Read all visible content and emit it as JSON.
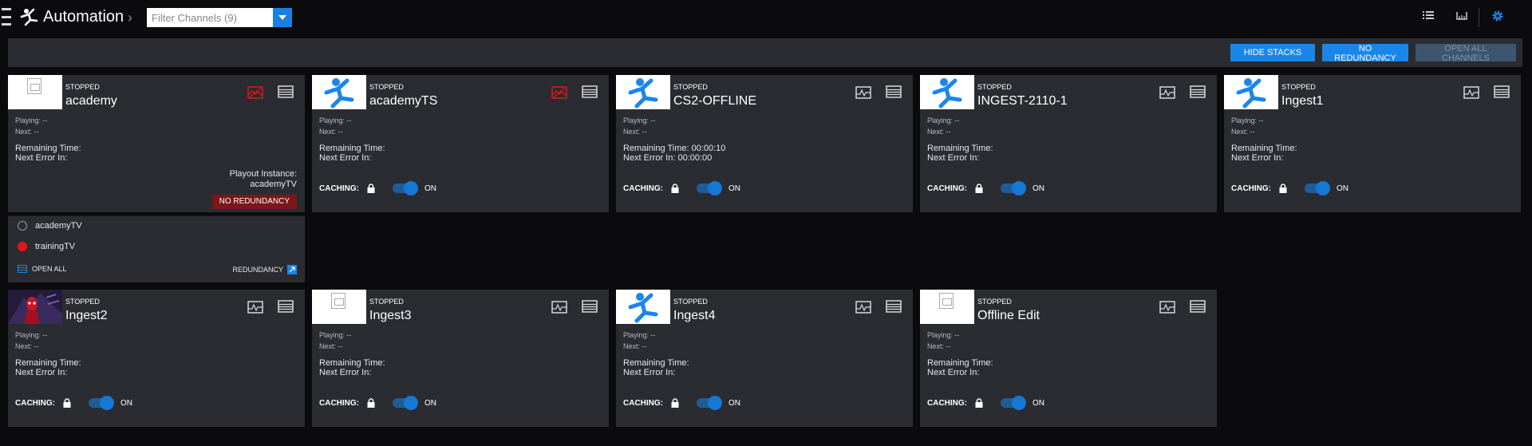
{
  "app": {
    "title": "Automation",
    "filter_placeholder": "Filter Channels (9)"
  },
  "toolbar": {
    "hide_stacks": "HIDE STACKS",
    "no_redundancy": "NO REDUNDANCY",
    "open_all_channels": "OPEN ALL CHANNELS"
  },
  "labels": {
    "playing": "Playing: --",
    "next": "Next: --",
    "remaining": "Remaining Time:",
    "next_error": "Next Error In:",
    "caching": "CACHING:",
    "on": "ON",
    "playout_instance": "Playout Instance:"
  },
  "channels": [
    {
      "name": "academy",
      "status": "STOPPED",
      "thumbnail": "placeholder-doc-icon",
      "signal_alert": true
    },
    {
      "name": "academyTS",
      "status": "STOPPED",
      "thumbnail": "runner-logo",
      "signal_alert": true,
      "caching": "ON"
    },
    {
      "name": "CS2-OFFLINE",
      "status": "STOPPED",
      "thumbnail": "runner-logo",
      "remaining": "Remaining Time: 00:00:10",
      "next_error": "Next Error In: 00:00:00",
      "caching": "ON"
    },
    {
      "name": "INGEST-2110-1",
      "status": "STOPPED",
      "thumbnail": "runner-logo",
      "caching": "ON"
    },
    {
      "name": "Ingest1",
      "status": "STOPPED",
      "thumbnail": "runner-logo",
      "caching": "ON"
    },
    {
      "name": "Ingest2",
      "status": "STOPPED",
      "thumbnail": "video-frame",
      "caching": "ON"
    },
    {
      "name": "Ingest3",
      "status": "STOPPED",
      "thumbnail": "placeholder-doc-icon",
      "caching": "ON"
    },
    {
      "name": "Ingest4",
      "status": "STOPPED",
      "thumbnail": "runner-logo",
      "caching": "ON"
    },
    {
      "name": "Offline Edit",
      "status": "STOPPED",
      "thumbnail": "placeholder-doc-icon",
      "caching": "ON"
    }
  ],
  "academy_playout": {
    "instance": "academyTV",
    "badge": "NO REDUNDANCY"
  },
  "stack": {
    "items": [
      {
        "name": "academyTV",
        "state": "inactive"
      },
      {
        "name": "trainingTV",
        "state": "active-red"
      }
    ],
    "open_all": "OPEN ALL",
    "redundancy": "REDUNDANCY"
  },
  "colors": {
    "accent": "#1a86ea",
    "alert": "#e3151b",
    "card_bg": "#2b2c31",
    "badge_red": "#7d1519"
  }
}
